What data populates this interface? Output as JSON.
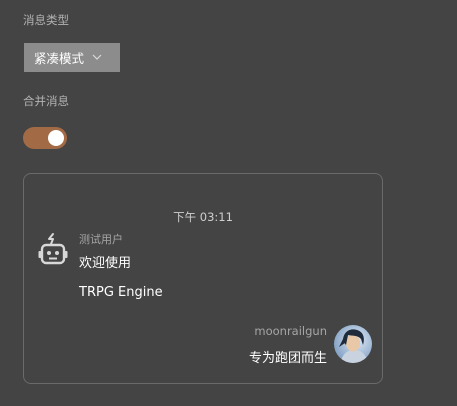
{
  "settings": {
    "message_type_label": "消息类型",
    "message_type_value": "紧凑模式",
    "merge_label": "合并消息",
    "merge_enabled": true
  },
  "preview": {
    "time": "下午 03:11",
    "incoming": {
      "icon": "robot-icon",
      "sender": "测试用户",
      "lines": [
        "欢迎使用",
        "TRPG Engine"
      ]
    },
    "outgoing": {
      "sender": "moonrailgun",
      "text": "专为跑团而生",
      "avatar": "user-avatar"
    }
  },
  "colors": {
    "background": "#444444",
    "select_bg": "#8c8c8c",
    "toggle_on": "#a36a46",
    "border": "#6a6a6a"
  }
}
